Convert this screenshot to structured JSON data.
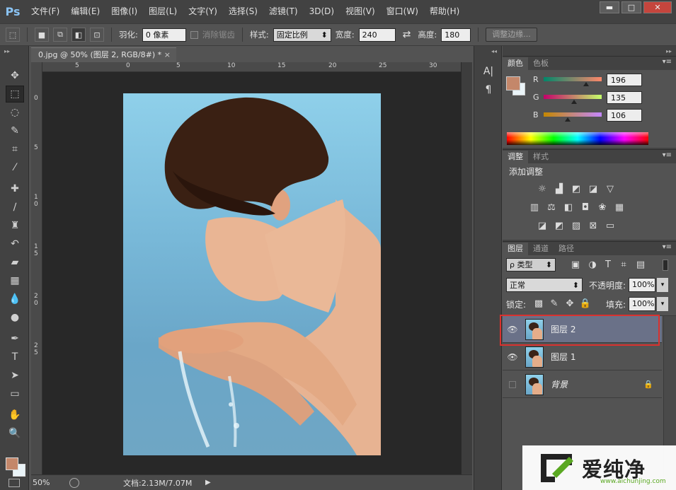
{
  "menubar": {
    "logo": "Ps",
    "items": [
      "文件(F)",
      "编辑(E)",
      "图像(I)",
      "图层(L)",
      "文字(Y)",
      "选择(S)",
      "滤镜(T)",
      "3D(D)",
      "视图(V)",
      "窗口(W)",
      "帮助(H)"
    ],
    "win_min": "▬",
    "win_max": "□",
    "win_close": "✕"
  },
  "options": {
    "feather_label": "羽化:",
    "feather_value": "0 像素",
    "antialias_label": "消除锯齿",
    "style_label": "样式:",
    "style_value": "固定比例",
    "width_label": "宽度:",
    "width_value": "240",
    "swap_icon": "⇄",
    "height_label": "高度:",
    "height_value": "180",
    "refine_edge": "调整边缘..."
  },
  "document": {
    "tab_title": "0.jpg @ 50% (图层 2, RGB/8#) *",
    "tab_close": "×",
    "ruler_h": [
      "5",
      "0",
      "5",
      "10",
      "15",
      "20",
      "25",
      "30"
    ],
    "ruler_v": [
      "0",
      "5",
      "1",
      "0",
      "1",
      "5",
      "2",
      "0",
      "2",
      "5"
    ],
    "zoom": "50%",
    "doc_info": "文档:2.13M/7.07M"
  },
  "color_panel": {
    "tabs": [
      "颜色",
      "色板"
    ],
    "r_label": "R",
    "r_value": "196",
    "g_label": "G",
    "g_value": "135",
    "b_label": "B",
    "b_value": "106",
    "foreground": "#c4876a"
  },
  "adjust_panel": {
    "tabs": [
      "调整",
      "样式"
    ],
    "title": "添加调整"
  },
  "layers_panel": {
    "tabs": [
      "图层",
      "通道",
      "路径"
    ],
    "filter_kind": "ρ 类型",
    "blend_mode": "正常",
    "opacity_label": "不透明度:",
    "opacity_value": "100%",
    "lock_label": "锁定:",
    "fill_label": "填充:",
    "fill_value": "100%",
    "layers": [
      {
        "name": "图层 2",
        "visible": true,
        "selected": true
      },
      {
        "name": "图层 1",
        "visible": true,
        "selected": false
      },
      {
        "name": "背景",
        "visible": false,
        "selected": false,
        "locked": true
      }
    ]
  },
  "watermark": {
    "text": "爱纯净",
    "url": "www.aichunjing.com"
  }
}
